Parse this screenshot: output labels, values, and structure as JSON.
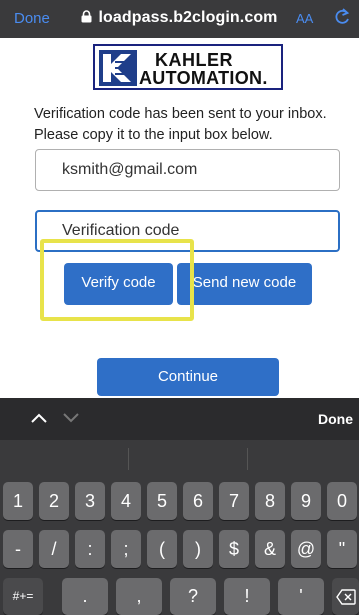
{
  "browser": {
    "done_label": "Done",
    "url": "loadpass.b2clogin.com",
    "text_size_label": "AA"
  },
  "logo": {
    "line1": "KAHLER",
    "line2": "AUTOMATION."
  },
  "form": {
    "message": "Verification code has been sent to your inbox. Please copy it to the input box below.",
    "email_value": "ksmith@gmail.com",
    "code_placeholder": "Verification code",
    "verify_label": "Verify code",
    "send_new_label": "Send new code",
    "continue_label": "Continue"
  },
  "keyboard": {
    "done_label": "Done",
    "row1": [
      "1",
      "2",
      "3",
      "4",
      "5",
      "6",
      "7",
      "8",
      "9",
      "0"
    ],
    "row2": [
      "-",
      "/",
      ":",
      ";",
      "(",
      ")",
      "$",
      "&",
      "@",
      "\""
    ],
    "row3_symbols_label": "#+=",
    "row3": [
      ".",
      ",",
      "?",
      "!",
      "'"
    ]
  },
  "colors": {
    "accent_blue": "#2f6fc7",
    "highlight_yellow": "#e8e34a",
    "keyboard_bg": "#3a3a3c"
  }
}
